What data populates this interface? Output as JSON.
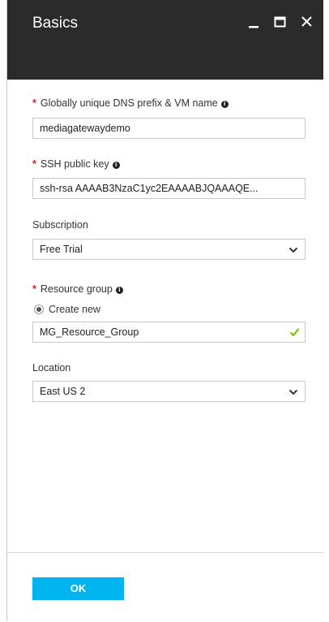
{
  "window": {
    "title": "Basics",
    "controls": [
      "minimize-icon",
      "maximize-icon",
      "close-icon"
    ]
  },
  "colors": {
    "header_bg": "#2b2b2b",
    "required_marker": "#d81b1b",
    "ok_button": "#00b4f0",
    "valid_check": "#7ab800"
  },
  "fields": {
    "dns_prefix": {
      "required": "*",
      "label": "Globally unique DNS prefix & VM name",
      "value": "mediagatewaydemo"
    },
    "ssh_key": {
      "required": "*",
      "label": "SSH public key",
      "value": "ssh-rsa AAAAB3NzaC1yc2EAAAABJQAAAQE..."
    },
    "subscription": {
      "label": "Subscription",
      "selected": "Free Trial"
    },
    "resource_group": {
      "required": "*",
      "label": "Resource group",
      "radio_label": "Create new",
      "value": "MG_Resource_Group"
    },
    "location": {
      "label": "Location",
      "selected": "East US 2"
    }
  },
  "footer": {
    "ok_label": "OK"
  }
}
